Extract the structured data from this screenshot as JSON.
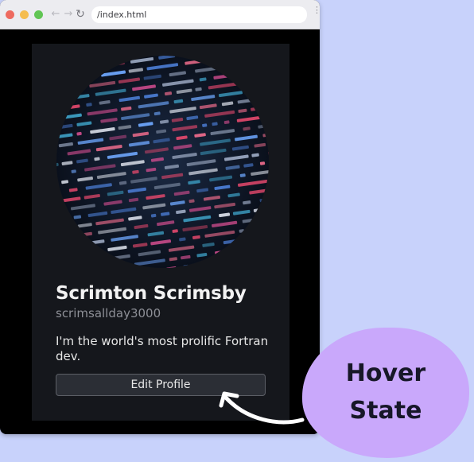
{
  "browser": {
    "url": "/index.html",
    "controls": {
      "back": "←",
      "forward": "→",
      "reload": "↻",
      "menu": "⋮"
    }
  },
  "profile": {
    "name": "Scrimton Scrimsby",
    "handle": "scrimsallday3000",
    "bio": "I'm the world's most prolific Fortran dev.",
    "edit_button_label": "Edit Profile"
  },
  "annotation": {
    "label_line1": "Hover",
    "label_line2": "State"
  },
  "colors": {
    "page_background": "#c8d2fb",
    "card_background": "#15171c",
    "button_background": "#2b2e35",
    "annotation_blob": "#c9a8fb"
  },
  "icons": [
    "back-arrow-icon",
    "forward-arrow-icon",
    "reload-icon",
    "menu-dots-icon",
    "curved-arrow-icon"
  ]
}
